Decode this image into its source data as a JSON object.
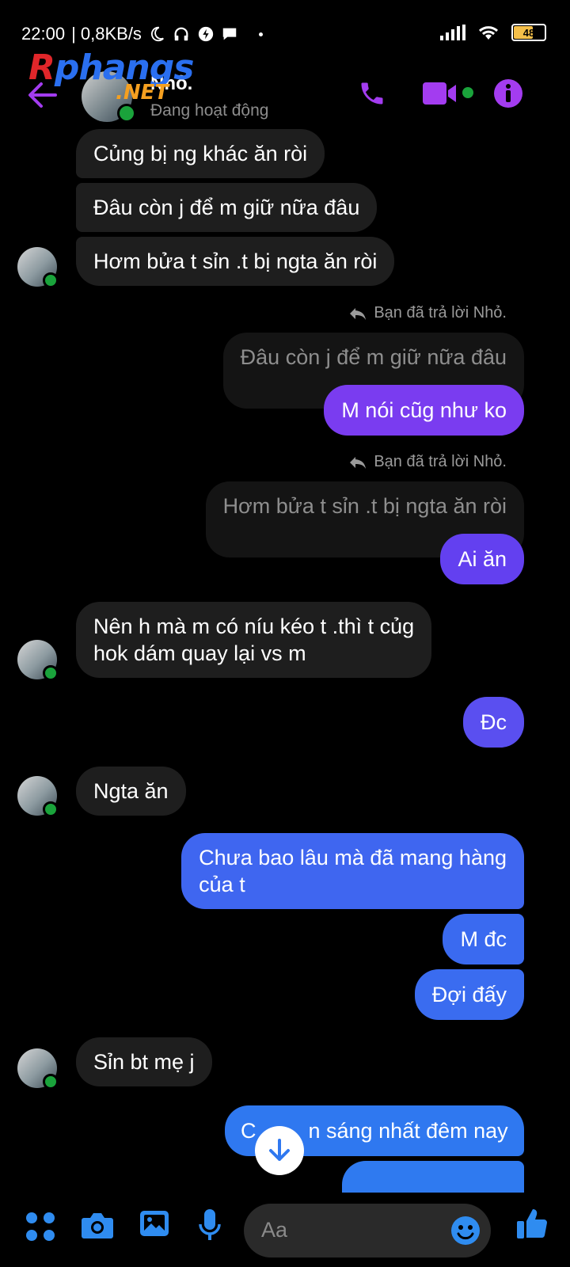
{
  "status_bar": {
    "time": "22:00",
    "net_speed": "| 0,8KB/s",
    "battery": "48"
  },
  "watermark": {
    "part1": "R",
    "part2": "phangs",
    "part3": ".NET"
  },
  "header": {
    "contact_name": "Nhỏ.",
    "status": "Đang hoạt động"
  },
  "messages": {
    "m1": "Củng bị ng khác ăn ròi",
    "m2": "Đâu còn j để m giữ nữa đâu",
    "m3": "Hơm bửa t sỉn .t bị ngta ăn ròi",
    "reply_note_1": "Bạn đã trả lời Nhỏ.",
    "quoted_1": "Đâu còn j để m giữ nữa đâu",
    "m4": "M nói cũg như ko",
    "reply_note_2": "Bạn đã trả lời Nhỏ.",
    "quoted_2": "Hơm bửa t sỉn .t bị ngta ăn ròi",
    "m5": "Ai ăn",
    "m6_line1": "Nên h mà m có níu kéo t .thì t củg",
    "m6_line2": "hok dám quay lại vs m",
    "m7": "Đc",
    "m8": "Ngta ăn",
    "m9_line1": "Chưa bao lâu mà đã mang hàng",
    "m9_line2": "của t",
    "m10": "M đc",
    "m11": "Đợi đấy",
    "m12": "Sỉn bt mẹ j",
    "m13_start": "C",
    "m13_end": "n sáng nhất đêm nay"
  },
  "composer": {
    "placeholder": "Aa"
  },
  "colors": {
    "purple": "#a33cf0",
    "violet": "#7a3cf0",
    "indigo": "#5a4ff0",
    "blue": "#3a6af0",
    "composer_blue": "#2f8cf0"
  }
}
